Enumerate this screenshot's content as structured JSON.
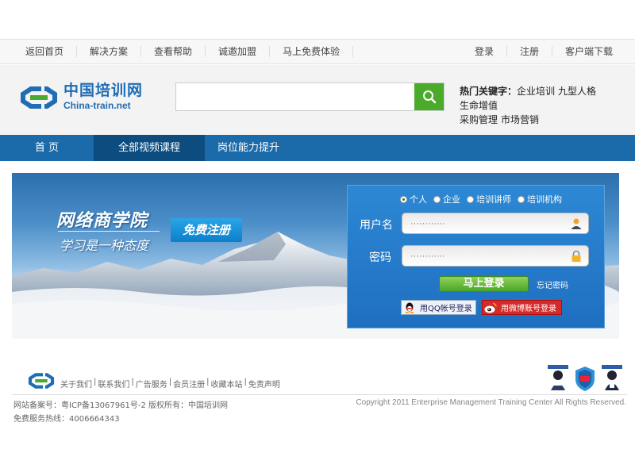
{
  "topbar": {
    "left_links": [
      "返回首页",
      "解决方案",
      "查看帮助",
      "诚邀加盟",
      "马上免费体验"
    ],
    "right_links": [
      "登录",
      "注册",
      "客户端下载"
    ]
  },
  "header": {
    "logo_cn": "中国培训网",
    "logo_en": "China-train.net",
    "search_placeholder": "",
    "hot_label": "热门关键字：",
    "hot_words": [
      "企业培训",
      "九型人格",
      "生命增值",
      "采购管理",
      "市场营销"
    ]
  },
  "mainnav": {
    "tabs": [
      "首 页",
      "全部视频课程",
      "岗位能力提升"
    ],
    "active_tab": "全部视频课程"
  },
  "banner": {
    "title": "网络商学院",
    "subtitle": "学习是一种态度",
    "register_label": "免费注册"
  },
  "login": {
    "roles": [
      "个人",
      "企业",
      "培训讲师",
      "培训机构"
    ],
    "selected_role": "个人",
    "username_label": "用户名",
    "password_label": "密码",
    "username_placeholder": "············",
    "password_placeholder": "············",
    "submit_label": "马上登录",
    "forgot_label": "忘记密码",
    "qq_label": "用QQ帐号登录",
    "weibo_label": "用微博账号登录"
  },
  "footer": {
    "links": [
      "关于我们",
      "联系我们",
      "广告服务",
      "会员注册",
      "收藏本站",
      "免责声明"
    ],
    "separator": "|",
    "icp": "网站备案号：粤ICP备13067961号-2 版权所有：中国培训网",
    "copyright": "Copyright 2011 Enterprise Management Training Center All Rights Reserved.",
    "hotline": "免费服务热线：4006664343"
  },
  "colors": {
    "brand_blue": "#1f6db5",
    "nav_blue": "#1b6aa9",
    "nav_active": "#0c4c7e",
    "search_green": "#4aaa2a",
    "login_green": "#4aa527",
    "weibo_red": "#d42a2a"
  }
}
